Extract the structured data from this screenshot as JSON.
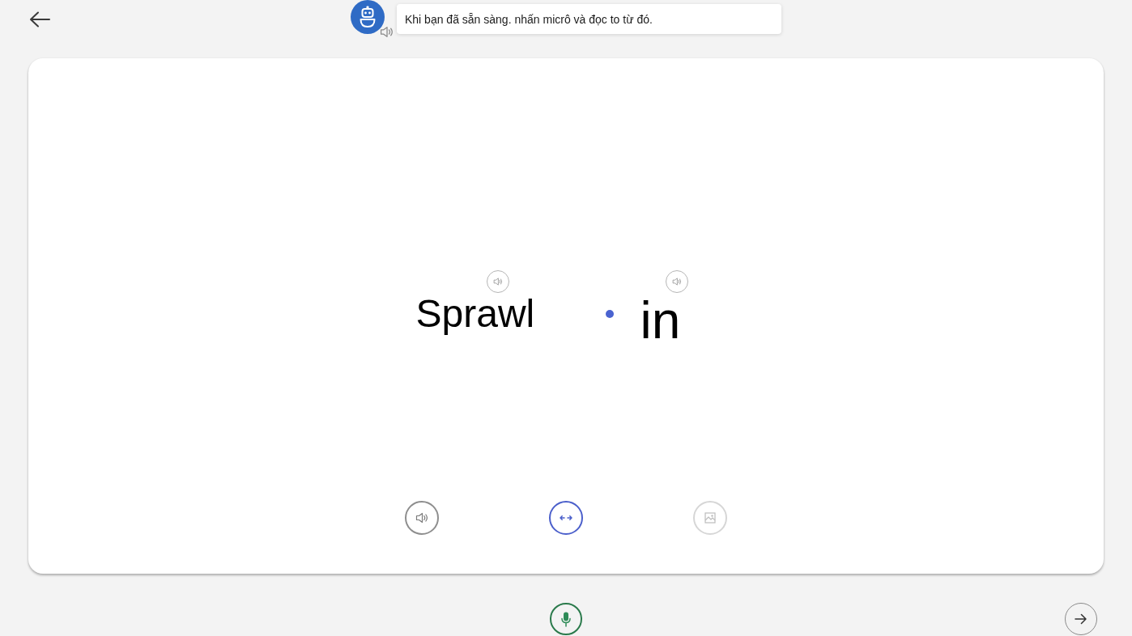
{
  "header": {
    "assistant": {
      "message": "Khi bạn đã sẵn sàng. nhấn micrô và đọc to từ đó."
    }
  },
  "card": {
    "words": [
      {
        "text": "Sprawl"
      },
      {
        "text": "in"
      }
    ],
    "controls": [
      {
        "kind": "speaker",
        "selected": false,
        "disabled": false
      },
      {
        "kind": "swap",
        "selected": true,
        "disabled": false
      },
      {
        "kind": "image",
        "selected": false,
        "disabled": true
      }
    ]
  }
}
